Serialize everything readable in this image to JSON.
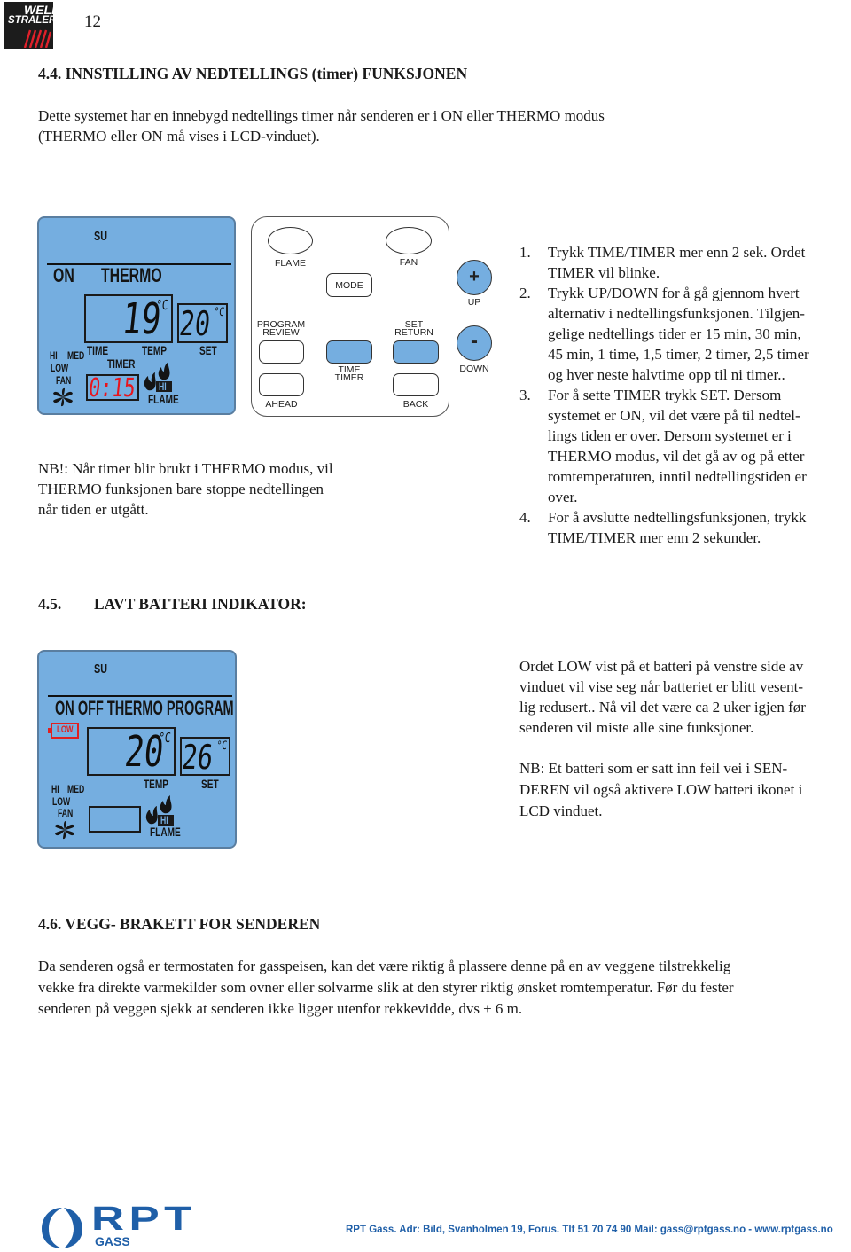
{
  "header": {
    "brand_line1": "WELL",
    "brand_line2": "STRALER",
    "page_number": "12"
  },
  "section_44": {
    "title": "4.4.  INNSTILLING AV NEDTELLINGS (timer) FUNKSJONEN",
    "intro_line1": "Dette systemet har en innebygd nedtellings timer når senderen er i  ON eller THERMO modus",
    "intro_line2": "(THERMO eller ON må vises i LCD-vinduet).",
    "lcd": {
      "day": "SU",
      "mode_on": "ON",
      "mode_thermo": "THERMO",
      "temp_value": "19",
      "temp_unit": "°C",
      "set_value": "20",
      "set_unit": "°C",
      "label_time": "TIME",
      "label_temp": "TEMP",
      "label_set": "SET",
      "label_timer": "TIMER",
      "timer_value": "0:15",
      "fan_hi": "HI",
      "fan_med": "MED",
      "fan_low": "LOW",
      "fan_label": "FAN",
      "flame_hi": "HI",
      "flame_label": "FLAME",
      "timer_color": "#e8141c"
    },
    "remote": {
      "flame": "FLAME",
      "fan": "FAN",
      "mode": "MODE",
      "program_review_1": "PROGRAM",
      "program_review_2": "REVIEW",
      "set_return_1": "SET",
      "set_return_2": "RETURN",
      "time_timer_1": "TIME",
      "time_timer_2": "TIMER",
      "ahead": "AHEAD",
      "back": "BACK",
      "up_symbol": "+",
      "up_label": "UP",
      "down_symbol": "-",
      "down_label": "DOWN",
      "accent_color": "#75aee0"
    },
    "nb_lines": [
      "NB!: Når timer blir brukt i THERMO modus, vil",
      "THERMO funksjonen bare stoppe nedtellingen",
      "når tiden er utgått."
    ],
    "steps": [
      {
        "num": "1.",
        "lines": [
          "Trykk TIME/TIMER mer enn 2 sek. Ordet",
          "TIMER vil blinke."
        ]
      },
      {
        "num": "2.",
        "lines": [
          "Trykk UP/DOWN for å gå gjennom hvert",
          "alternativ i nedtellingsfunksjonen. Tilgjen-",
          "gelige nedtellings tider er 15 min, 30 min,",
          "45 min, 1 time, 1,5 timer, 2 timer, 2,5 timer",
          "og hver neste halvtime opp til ni timer.."
        ]
      },
      {
        "num": "3.",
        "lines": [
          "For å sette  TIMER trykk SET. Dersom",
          "systemet er ON, vil det være på til nedtel-",
          "lings tiden er over. Dersom systemet er i",
          "THERMO modus, vil det gå av og på etter",
          "romtemperaturen, inntil nedtellingstiden er",
          "over."
        ]
      },
      {
        "num": "4.",
        "lines": [
          "For å avslutte nedtellingsfunksjonen, trykk",
          "TIME/TIMER mer enn 2 sekunder."
        ]
      }
    ]
  },
  "section_45": {
    "title_num": "4.5.",
    "title": "LAVT BATTERI INDIKATOR:",
    "lcd": {
      "day": "SU",
      "modes": "ON OFF THERMO PROGRAM",
      "battery_label": "LOW",
      "battery_color": "#e02020",
      "temp_value": "20",
      "temp_unit": "°C",
      "set_value": "26",
      "set_unit": "°C",
      "label_temp": "TEMP",
      "label_set": "SET",
      "fan_hi": "HI",
      "fan_med": "MED",
      "fan_low": "LOW",
      "fan_label": "FAN",
      "flame_hi": "HI",
      "flame_label": "FLAME"
    },
    "para1": [
      "Ordet LOW vist på et  batteri på venstre side av",
      "vinduet vil vise seg når batteriet er blitt vesent-",
      "lig redusert.. Nå vil det være ca 2 uker igjen før",
      "senderen vil miste alle sine funksjoner."
    ],
    "para2": [
      "NB: Et batteri som er satt inn feil vei i SEN-",
      "DEREN vil også aktivere LOW batteri ikonet i",
      "LCD vinduet."
    ]
  },
  "section_46": {
    "title": "4.6.  VEGG- BRAKETT FOR SENDEREN",
    "lines": [
      "Da senderen også er termostaten for gasspeisen, kan det være riktig å plassere denne på en av veggene tilstrekkelig",
      "vekke fra direkte varmekilder som ovner eller solvarme slik at den styrer riktig ønsket romtemperatur.  Før du fester",
      "senderen på veggen sjekk at senderen ikke ligger utenfor rekkevidde, dvs  ± 6 m."
    ]
  },
  "footer": {
    "logo_main": "RPT",
    "logo_sub": "GASS",
    "contact": "RPT Gass. Adr: Bild, Svanholmen 19, Forus. Tlf 51 70 74 90 Mail: gass@rptgass.no - www.rptgass.no",
    "brand_color": "#1f5fa8"
  }
}
